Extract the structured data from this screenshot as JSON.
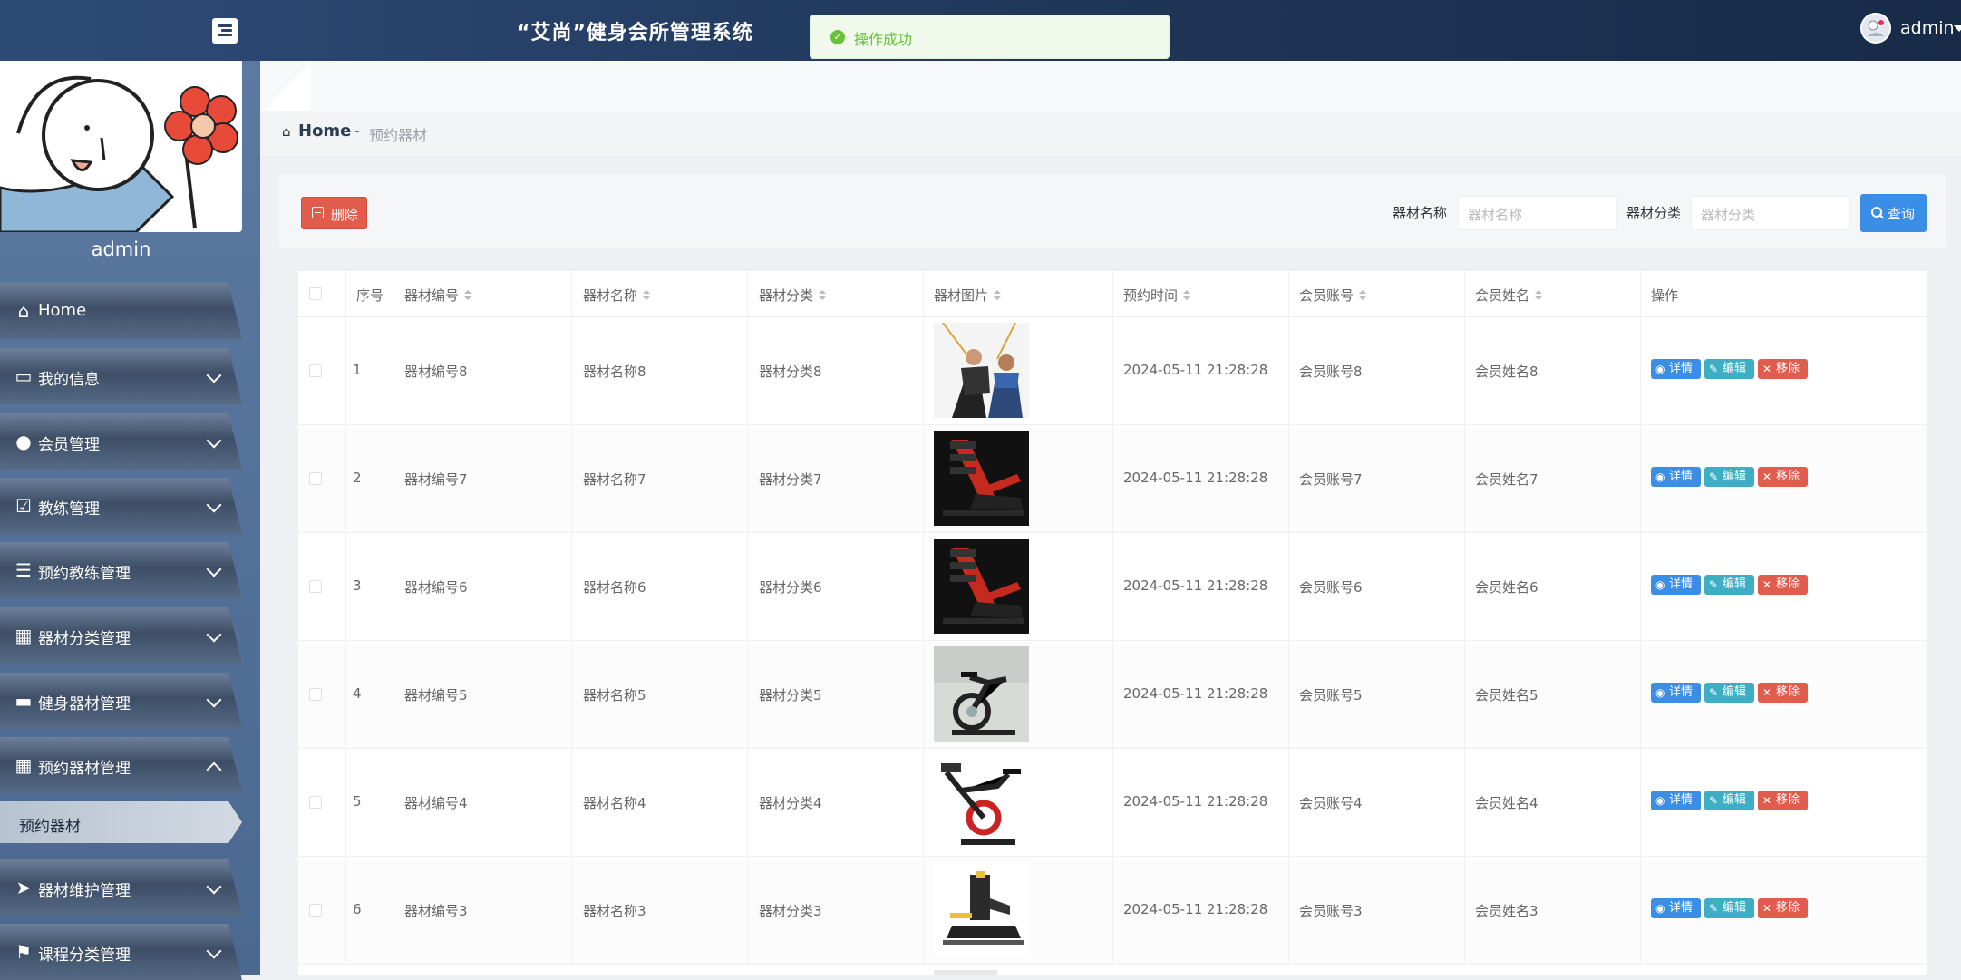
{
  "app": {
    "title": "“艾尚”健身会所管理系统"
  },
  "toast": {
    "text": "操作成功",
    "color": "#67c23a"
  },
  "user": {
    "name": "admin"
  },
  "sidebar": {
    "profile_name": "admin",
    "items": [
      {
        "label": "Home",
        "icon": "home-icon"
      },
      {
        "label": "我的信息",
        "icon": "id-card-icon"
      },
      {
        "label": "会员管理",
        "icon": "lightbulb-icon"
      },
      {
        "label": "教练管理",
        "icon": "clipboard-check-icon"
      },
      {
        "label": "预约教练管理",
        "icon": "sliders-icon"
      },
      {
        "label": "器材分类管理",
        "icon": "grid-icon"
      },
      {
        "label": "健身器材管理",
        "icon": "paint-roller-icon"
      },
      {
        "label": "预约器材管理",
        "icon": "grid-icon",
        "expanded": true
      },
      {
        "label": "预约器材",
        "icon": "",
        "sub": true,
        "active": true
      },
      {
        "label": "器材维护管理",
        "icon": "paper-plane-icon"
      },
      {
        "label": "课程分类管理",
        "icon": "flag-icon"
      }
    ]
  },
  "breadcrumb": {
    "home": "Home",
    "separator": "-",
    "current": "预约器材"
  },
  "toolbar": {
    "delete_label": "删除",
    "query_label": "查询",
    "filters": [
      {
        "label": "器材名称",
        "placeholder": "器材名称"
      },
      {
        "label": "器材分类",
        "placeholder": "器材分类"
      }
    ]
  },
  "table": {
    "columns": [
      "序号",
      "器材编号",
      "器材名称",
      "器材分类",
      "器材图片",
      "预约时间",
      "会员账号",
      "会员姓名",
      "操作"
    ],
    "actions": {
      "detail": "详情",
      "edit": "编辑",
      "remove": "移除"
    },
    "rows": [
      {
        "index": "1",
        "code": "器材编号8",
        "name": "器材名称8",
        "category": "器材分类8",
        "image": "trainer-photo",
        "time": "2024-05-11 21:28:28",
        "account": "会员账号8",
        "member": "会员姓名8"
      },
      {
        "index": "2",
        "code": "器材编号7",
        "name": "器材名称7",
        "category": "器材分类7",
        "image": "leg-press-photo",
        "time": "2024-05-11 21:28:28",
        "account": "会员账号7",
        "member": "会员姓名7"
      },
      {
        "index": "3",
        "code": "器材编号6",
        "name": "器材名称6",
        "category": "器材分类6",
        "image": "leg-press-photo",
        "time": "2024-05-11 21:28:28",
        "account": "会员账号6",
        "member": "会员姓名6"
      },
      {
        "index": "4",
        "code": "器材编号5",
        "name": "器材名称5",
        "category": "器材分类5",
        "image": "spin-bike-photo",
        "time": "2024-05-11 21:28:28",
        "account": "会员账号5",
        "member": "会员姓名5"
      },
      {
        "index": "5",
        "code": "器材编号4",
        "name": "器材名称4",
        "category": "器材分类4",
        "image": "spin-bike-red-photo",
        "time": "2024-05-11 21:28:28",
        "account": "会员账号4",
        "member": "会员姓名4"
      },
      {
        "index": "6",
        "code": "器材编号3",
        "name": "器材名称3",
        "category": "器材分类3",
        "image": "row-machine-photo",
        "time": "2024-05-11 21:28:28",
        "account": "会员账号3",
        "member": "会员姓名3"
      }
    ]
  }
}
